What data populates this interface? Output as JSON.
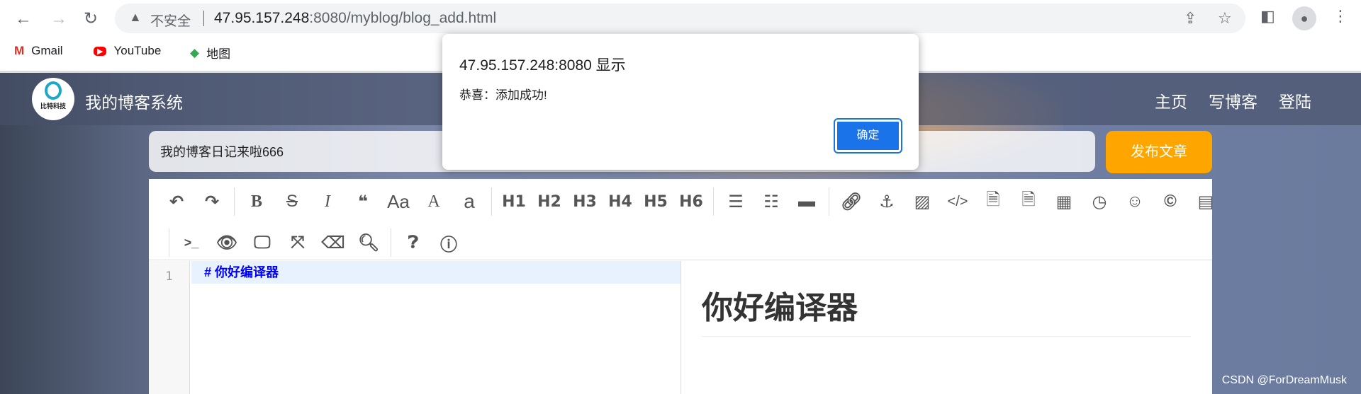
{
  "browser": {
    "insecure_label": "不安全",
    "url_host": "47.95.157.248",
    "url_rest": ":8080/myblog/blog_add.html",
    "bookmarks": [
      {
        "label": "Gmail",
        "icon": "gmail-icon"
      },
      {
        "label": "YouTube",
        "icon": "youtube-icon"
      },
      {
        "label": "地图",
        "icon": "maps-icon"
      }
    ]
  },
  "site": {
    "logo_text": "比特科技",
    "title": "我的博客系统",
    "nav": [
      "主页",
      "写博客",
      "登陆"
    ]
  },
  "form": {
    "title_value": "我的博客日记来啦666",
    "publish_label": "发布文章"
  },
  "editor": {
    "line_number": "1",
    "code_line": "# 你好编译器",
    "preview_heading": "你好编译器",
    "toolbar_text": {
      "heading_labels": [
        "H1",
        "H2",
        "H3",
        "H4",
        "H5",
        "H6"
      ]
    }
  },
  "dialog": {
    "title": "47.95.157.248:8080 显示",
    "message": "恭喜：添加成功!",
    "ok_label": "确定"
  },
  "watermark": "CSDN @ForDreamMusk",
  "colors": {
    "publish": "#ffa500",
    "dialog_button": "#1a73e8",
    "code_text": "#0000ff"
  }
}
